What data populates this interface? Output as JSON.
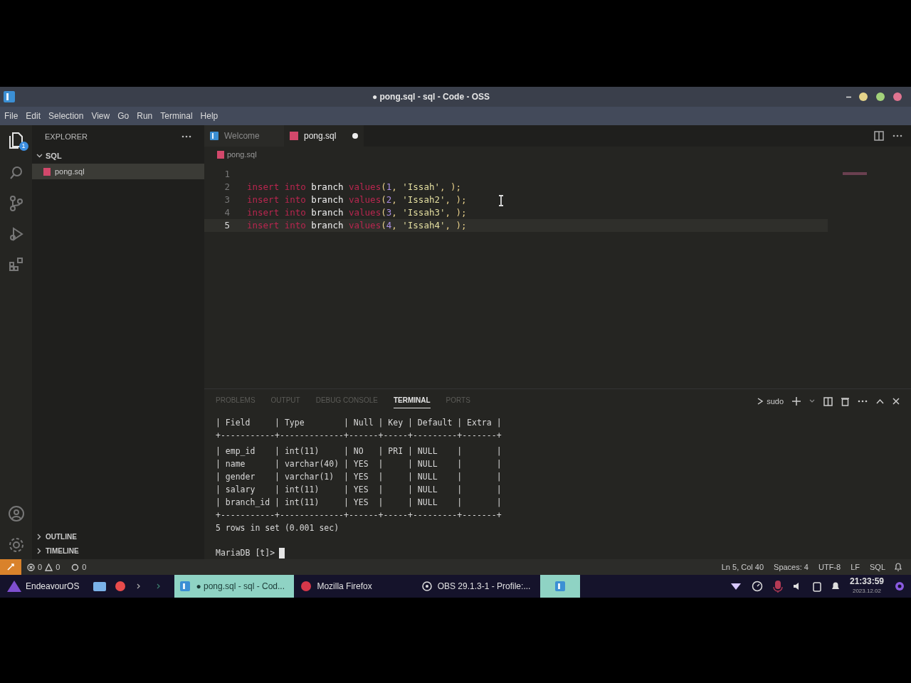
{
  "window": {
    "title": "● pong.sql - sql - Code - OSS"
  },
  "menu": [
    "File",
    "Edit",
    "Selection",
    "View",
    "Go",
    "Run",
    "Terminal",
    "Help"
  ],
  "activity_bar": {
    "badge": "1"
  },
  "sidebar": {
    "title": "EXPLORER",
    "folder": {
      "name": "SQL",
      "expanded": true,
      "children": [
        {
          "name": "pong.sql",
          "selected": true
        }
      ]
    },
    "sections": [
      {
        "name": "OUTLINE",
        "expanded": false
      },
      {
        "name": "TIMELINE",
        "expanded": false
      }
    ]
  },
  "tabs": [
    {
      "label": "Welcome",
      "kind": "welcome",
      "selected": false,
      "dirty": false
    },
    {
      "label": "pong.sql",
      "kind": "sql",
      "selected": true,
      "dirty": true
    }
  ],
  "breadcrumb": "pong.sql",
  "code": [
    {
      "number": "1",
      "current": false
    },
    {
      "number": "2",
      "current": false,
      "tokens": [
        {
          "kind": "keyword",
          "text": "insert into "
        },
        {
          "kind": "ident",
          "text": "branch "
        },
        {
          "kind": "keyword",
          "text": "values"
        },
        {
          "kind": "punct",
          "text": "("
        },
        {
          "kind": "number",
          "text": "1"
        },
        {
          "kind": "punct",
          "text": ", "
        },
        {
          "kind": "string",
          "text": "'Issah'"
        },
        {
          "kind": "punct",
          "text": ", );"
        }
      ]
    },
    {
      "number": "3",
      "current": false,
      "tokens": [
        {
          "kind": "keyword",
          "text": "insert into "
        },
        {
          "kind": "ident",
          "text": "branch "
        },
        {
          "kind": "keyword",
          "text": "values"
        },
        {
          "kind": "punct",
          "text": "("
        },
        {
          "kind": "number",
          "text": "2"
        },
        {
          "kind": "punct",
          "text": ", "
        },
        {
          "kind": "string",
          "text": "'Issah2'"
        },
        {
          "kind": "punct",
          "text": ", );"
        }
      ]
    },
    {
      "number": "4",
      "current": false,
      "tokens": [
        {
          "kind": "keyword",
          "text": "insert into "
        },
        {
          "kind": "ident",
          "text": "branch "
        },
        {
          "kind": "keyword",
          "text": "values"
        },
        {
          "kind": "punct",
          "text": "("
        },
        {
          "kind": "number",
          "text": "3"
        },
        {
          "kind": "punct",
          "text": ", "
        },
        {
          "kind": "string",
          "text": "'Issah3'"
        },
        {
          "kind": "punct",
          "text": ", );"
        }
      ]
    },
    {
      "number": "5",
      "current": true,
      "tokens": [
        {
          "kind": "keyword",
          "text": "insert into "
        },
        {
          "kind": "ident",
          "text": "branch "
        },
        {
          "kind": "keyword",
          "text": "values"
        },
        {
          "kind": "punct",
          "text": "("
        },
        {
          "kind": "number",
          "text": "4"
        },
        {
          "kind": "punct",
          "text": ", "
        },
        {
          "kind": "string",
          "text": "'Issah4'"
        },
        {
          "kind": "punct",
          "text": ", );"
        }
      ]
    }
  ],
  "panel": {
    "tabs": [
      {
        "label": "PROBLEMS",
        "selected": false
      },
      {
        "label": "OUTPUT",
        "selected": false
      },
      {
        "label": "DEBUG CONSOLE",
        "selected": false
      },
      {
        "label": "TERMINAL",
        "selected": true
      },
      {
        "label": "PORTS",
        "selected": false
      }
    ],
    "terminal_name": "sudo",
    "lines": [
      "| Field     | Type        | Null | Key | Default | Extra |",
      "+-----------+-------------+------+-----+---------+-------+",
      "| emp_id    | int(11)     | NO   | PRI | NULL    |       |",
      "| name      | varchar(40) | YES  |     | NULL    |       |",
      "| gender    | varchar(1)  | YES  |     | NULL    |       |",
      "| salary    | int(11)     | YES  |     | NULL    |       |",
      "| branch_id | int(11)     | YES  |     | NULL    |       |",
      "+-----------+-------------+------+-----+---------+-------+",
      "5 rows in set (0.001 sec)"
    ],
    "prompt": "MariaDB [t]>"
  },
  "status_bar": {
    "errors": "0",
    "warnings": "0",
    "ports": "0",
    "items": [
      "Ln 5, Col 40",
      "Spaces: 4",
      "UTF-8",
      "LF",
      "SQL"
    ]
  },
  "taskbar": {
    "launcher": "EndeavourOS",
    "tasks": [
      {
        "label": "● pong.sql - sql - Cod...",
        "kind": "code",
        "selected": true
      },
      {
        "label": "Mozilla Firefox",
        "kind": "firefox",
        "selected": false
      },
      {
        "label": "OBS 29.1.3-1 - Profile:...",
        "kind": "obs",
        "selected": false
      },
      {
        "kind": "code",
        "selected": true
      }
    ],
    "time": "21:33:59",
    "date": "2023.12.02"
  }
}
